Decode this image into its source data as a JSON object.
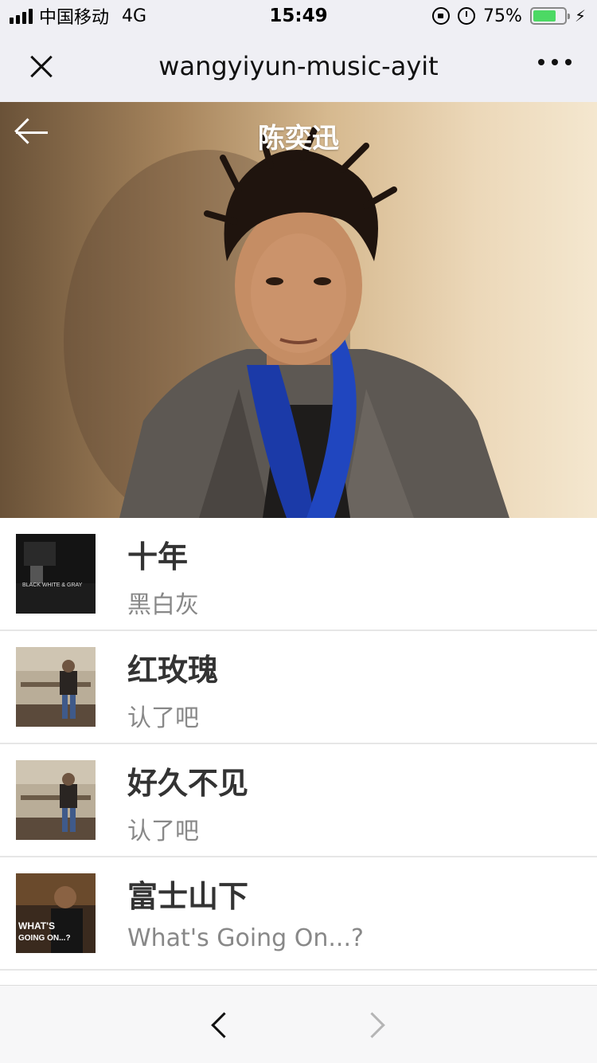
{
  "status_bar": {
    "carrier": "中国移动",
    "network": "4G",
    "time": "15:49",
    "battery_percent": "75%",
    "battery_level": 0.75,
    "battery_color": "#4cd964"
  },
  "nav": {
    "title": "wangyiyun-music-ayit",
    "close_icon": "close-icon",
    "more_icon": "more-dots-icon"
  },
  "artist": {
    "name": "陈奕迅"
  },
  "songs": [
    {
      "name": "十年",
      "album": "黑白灰"
    },
    {
      "name": "红玫瑰",
      "album": "认了吧"
    },
    {
      "name": "好久不见",
      "album": "认了吧"
    },
    {
      "name": "富士山下",
      "album": "What's Going On...?"
    }
  ],
  "cover_text": {
    "cover_1": "BLACK WHITE & GRAY",
    "cover_4_line1": "WHAT'S",
    "cover_4_line2": "GOING ON...?"
  },
  "toolbar": {
    "back_icon": "chevron-left-icon",
    "forward_icon": "chevron-right-icon"
  }
}
